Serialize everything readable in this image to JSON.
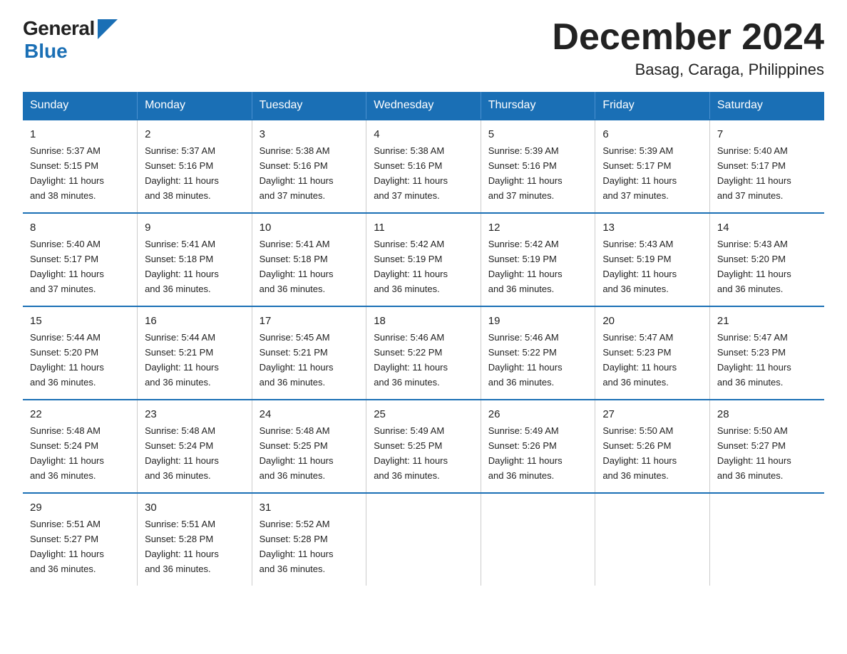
{
  "logo": {
    "general": "General",
    "blue": "Blue"
  },
  "title": "December 2024",
  "subtitle": "Basag, Caraga, Philippines",
  "days_of_week": [
    "Sunday",
    "Monday",
    "Tuesday",
    "Wednesday",
    "Thursday",
    "Friday",
    "Saturday"
  ],
  "weeks": [
    [
      {
        "day": "1",
        "sunrise": "5:37 AM",
        "sunset": "5:15 PM",
        "daylight": "11 hours and 38 minutes."
      },
      {
        "day": "2",
        "sunrise": "5:37 AM",
        "sunset": "5:16 PM",
        "daylight": "11 hours and 38 minutes."
      },
      {
        "day": "3",
        "sunrise": "5:38 AM",
        "sunset": "5:16 PM",
        "daylight": "11 hours and 37 minutes."
      },
      {
        "day": "4",
        "sunrise": "5:38 AM",
        "sunset": "5:16 PM",
        "daylight": "11 hours and 37 minutes."
      },
      {
        "day": "5",
        "sunrise": "5:39 AM",
        "sunset": "5:16 PM",
        "daylight": "11 hours and 37 minutes."
      },
      {
        "day": "6",
        "sunrise": "5:39 AM",
        "sunset": "5:17 PM",
        "daylight": "11 hours and 37 minutes."
      },
      {
        "day": "7",
        "sunrise": "5:40 AM",
        "sunset": "5:17 PM",
        "daylight": "11 hours and 37 minutes."
      }
    ],
    [
      {
        "day": "8",
        "sunrise": "5:40 AM",
        "sunset": "5:17 PM",
        "daylight": "11 hours and 37 minutes."
      },
      {
        "day": "9",
        "sunrise": "5:41 AM",
        "sunset": "5:18 PM",
        "daylight": "11 hours and 36 minutes."
      },
      {
        "day": "10",
        "sunrise": "5:41 AM",
        "sunset": "5:18 PM",
        "daylight": "11 hours and 36 minutes."
      },
      {
        "day": "11",
        "sunrise": "5:42 AM",
        "sunset": "5:19 PM",
        "daylight": "11 hours and 36 minutes."
      },
      {
        "day": "12",
        "sunrise": "5:42 AM",
        "sunset": "5:19 PM",
        "daylight": "11 hours and 36 minutes."
      },
      {
        "day": "13",
        "sunrise": "5:43 AM",
        "sunset": "5:19 PM",
        "daylight": "11 hours and 36 minutes."
      },
      {
        "day": "14",
        "sunrise": "5:43 AM",
        "sunset": "5:20 PM",
        "daylight": "11 hours and 36 minutes."
      }
    ],
    [
      {
        "day": "15",
        "sunrise": "5:44 AM",
        "sunset": "5:20 PM",
        "daylight": "11 hours and 36 minutes."
      },
      {
        "day": "16",
        "sunrise": "5:44 AM",
        "sunset": "5:21 PM",
        "daylight": "11 hours and 36 minutes."
      },
      {
        "day": "17",
        "sunrise": "5:45 AM",
        "sunset": "5:21 PM",
        "daylight": "11 hours and 36 minutes."
      },
      {
        "day": "18",
        "sunrise": "5:46 AM",
        "sunset": "5:22 PM",
        "daylight": "11 hours and 36 minutes."
      },
      {
        "day": "19",
        "sunrise": "5:46 AM",
        "sunset": "5:22 PM",
        "daylight": "11 hours and 36 minutes."
      },
      {
        "day": "20",
        "sunrise": "5:47 AM",
        "sunset": "5:23 PM",
        "daylight": "11 hours and 36 minutes."
      },
      {
        "day": "21",
        "sunrise": "5:47 AM",
        "sunset": "5:23 PM",
        "daylight": "11 hours and 36 minutes."
      }
    ],
    [
      {
        "day": "22",
        "sunrise": "5:48 AM",
        "sunset": "5:24 PM",
        "daylight": "11 hours and 36 minutes."
      },
      {
        "day": "23",
        "sunrise": "5:48 AM",
        "sunset": "5:24 PM",
        "daylight": "11 hours and 36 minutes."
      },
      {
        "day": "24",
        "sunrise": "5:48 AM",
        "sunset": "5:25 PM",
        "daylight": "11 hours and 36 minutes."
      },
      {
        "day": "25",
        "sunrise": "5:49 AM",
        "sunset": "5:25 PM",
        "daylight": "11 hours and 36 minutes."
      },
      {
        "day": "26",
        "sunrise": "5:49 AM",
        "sunset": "5:26 PM",
        "daylight": "11 hours and 36 minutes."
      },
      {
        "day": "27",
        "sunrise": "5:50 AM",
        "sunset": "5:26 PM",
        "daylight": "11 hours and 36 minutes."
      },
      {
        "day": "28",
        "sunrise": "5:50 AM",
        "sunset": "5:27 PM",
        "daylight": "11 hours and 36 minutes."
      }
    ],
    [
      {
        "day": "29",
        "sunrise": "5:51 AM",
        "sunset": "5:27 PM",
        "daylight": "11 hours and 36 minutes."
      },
      {
        "day": "30",
        "sunrise": "5:51 AM",
        "sunset": "5:28 PM",
        "daylight": "11 hours and 36 minutes."
      },
      {
        "day": "31",
        "sunrise": "5:52 AM",
        "sunset": "5:28 PM",
        "daylight": "11 hours and 36 minutes."
      },
      null,
      null,
      null,
      null
    ]
  ],
  "labels": {
    "sunrise": "Sunrise:",
    "sunset": "Sunset:",
    "daylight": "Daylight:"
  }
}
